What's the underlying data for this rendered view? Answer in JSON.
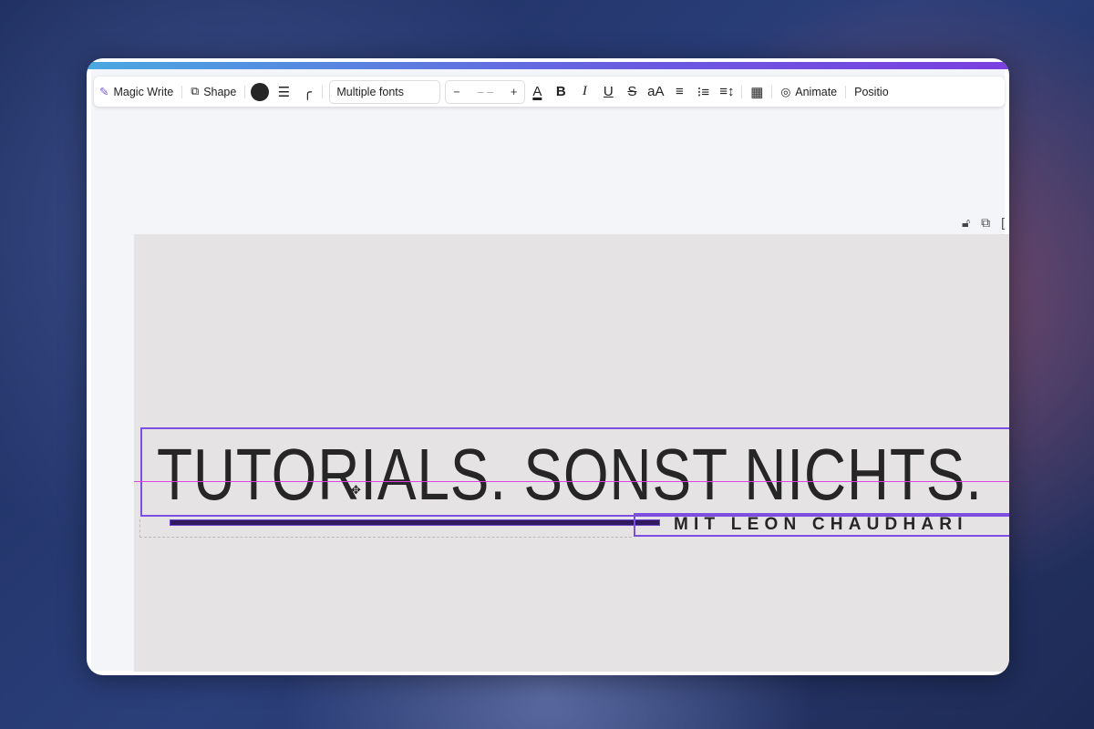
{
  "toolbar": {
    "magic_write": "Magic Write",
    "shape": "Shape",
    "font": "Multiple fonts",
    "size_minus": "−",
    "size_value": "– –",
    "size_plus": "+",
    "case": "aA",
    "animate": "Animate",
    "position": "Positio"
  },
  "canvas": {
    "headline": "TUTORIALS. SONST NICHTS.",
    "subtitle": "MIT LEON CHAUDHARI"
  },
  "colors": {
    "accent": "#7d4fe0",
    "guide": "#e040e0",
    "page": "#e5e3e3",
    "bar": "#2e1a5c"
  }
}
